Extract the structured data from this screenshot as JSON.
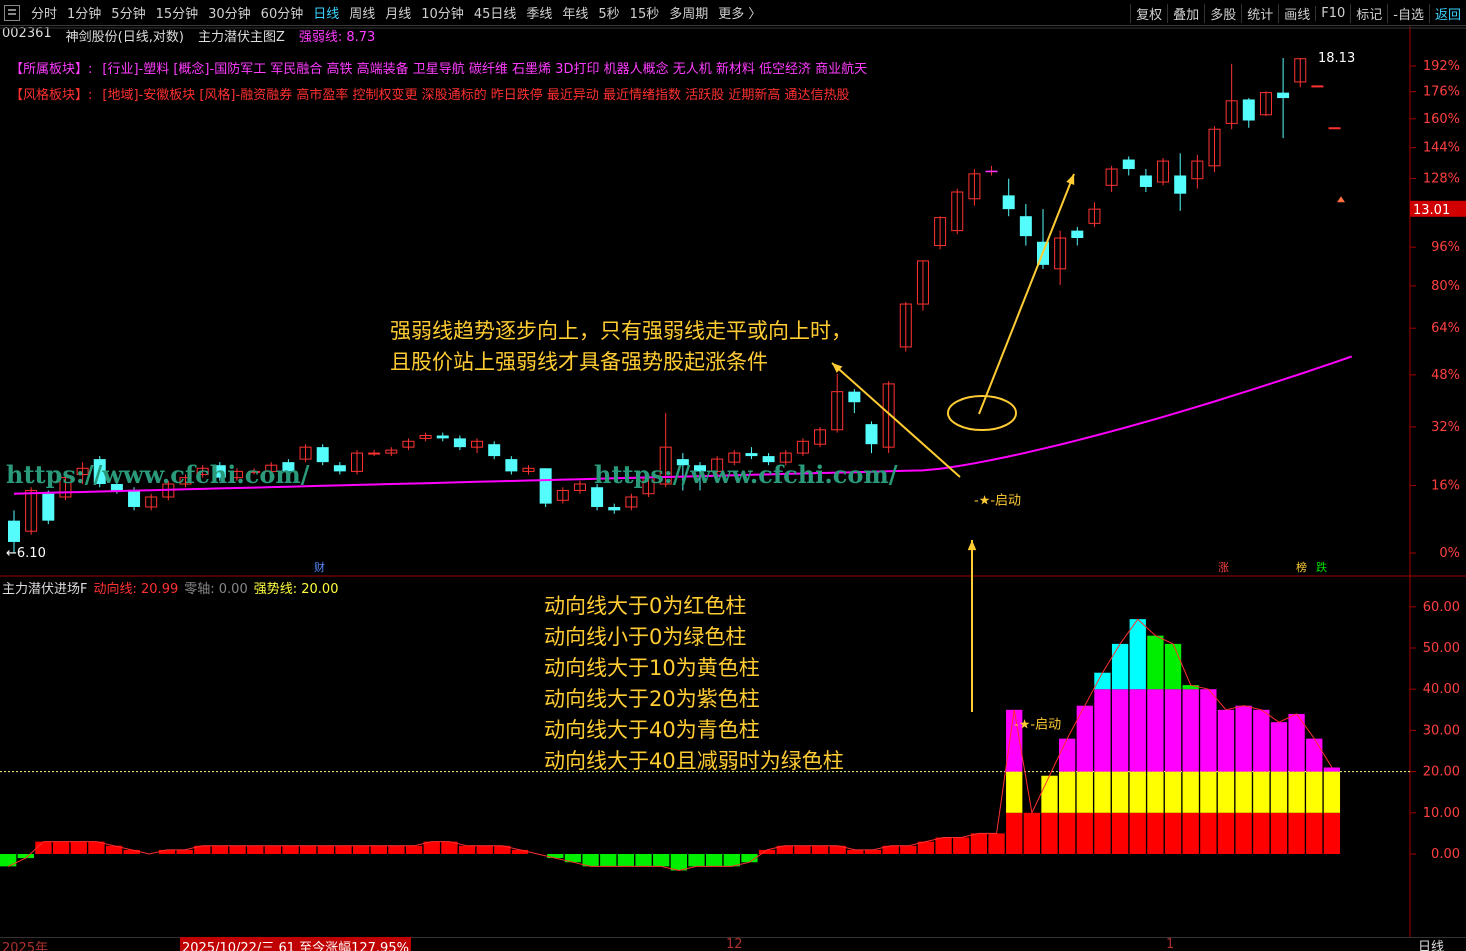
{
  "toolbar": {
    "periods": [
      "分时",
      "1分钟",
      "5分钟",
      "15分钟",
      "30分钟",
      "60分钟",
      "日线",
      "周线",
      "月线",
      "10分钟",
      "45日线",
      "季线",
      "年线",
      "5秒",
      "15秒",
      "多周期",
      "更多 〉"
    ],
    "active_period": "日线",
    "tools": [
      "复权",
      "叠加",
      "多股",
      "统计",
      "画线",
      "F10",
      "标记",
      "-自选",
      "返回"
    ]
  },
  "stock": {
    "code": "002361",
    "name": "神剑股份",
    "mode": "(日线,对数)",
    "indicator": "主力潜伏主图Z",
    "ind_label": "强弱线:",
    "ind_value": "8.73"
  },
  "sector": {
    "label": "【所属板块】:",
    "items": [
      "[行业]-塑料",
      "[概念]-国防军工",
      "军民融合",
      "高铁",
      "高端装备",
      "卫星导航",
      "碳纤维",
      "石墨烯",
      "3D打印",
      "机器人概念",
      "无人机",
      "新材料",
      "低空经济",
      "商业航天"
    ]
  },
  "style": {
    "label": "【风格板块】:",
    "items": [
      "[地域]-安徽板块",
      "[风格]-融资融券",
      "高市盈率",
      "控制权变更",
      "深股通标的",
      "昨日跌停",
      "最近异动",
      "最近情绪指数",
      "活跃股",
      "近期新高",
      "通达信热股"
    ]
  },
  "price_axis": [
    "192%",
    "176%",
    "160%",
    "144%",
    "128%",
    "96%",
    "80%",
    "64%",
    "48%",
    "32%",
    "16%",
    "0%"
  ],
  "current_price": "13.01",
  "high_label": "18.13",
  "low_label": "6.10",
  "start_label": "★-启动",
  "annotation_main": [
    "强弱线趋势逐步向上，只有强弱线走平或向上时，",
    "且股价站上强弱线才具备强势股起涨条件"
  ],
  "annotation_sub": [
    "动向线大于0为红色柱",
    "动向线小于0为绿色柱",
    "动向线大于10为黄色柱",
    "动向线大于20为紫色柱",
    "动向线大于40为青色柱",
    "动向线大于40且减弱时为绿色柱"
  ],
  "watermark": "https://www.cfchi.com/",
  "markers": {
    "cai": "财",
    "zhang": "涨",
    "bang": "榜",
    "die": "跌"
  },
  "sub": {
    "name": "主力潜伏进场F",
    "dx_label": "动向线:",
    "dx_value": "20.99",
    "zero_label": "零轴:",
    "zero_value": "0.00",
    "qs_label": "强势线:",
    "qs_value": "20.00"
  },
  "sub_axis": [
    "60.00",
    "50.00",
    "40.00",
    "30.00",
    "20.00",
    "10.00",
    "0.00"
  ],
  "bottom": {
    "year": "2025年",
    "date": "2025/10/22/三 61 至今涨幅127.95%",
    "m12": "12",
    "m1": "1",
    "period": "日线"
  },
  "colors": {
    "up": "#ff3232",
    "down": "#54fcfc",
    "strength_line": "#ff00ff",
    "annotation": "#ffcc33",
    "red": "#ff0000",
    "green": "#00ee00",
    "yellow": "#ffff00",
    "magenta": "#ff00ff",
    "cyan": "#00ffff"
  },
  "chart_data": {
    "type": "candlestick",
    "candles": [
      [
        6.55,
        6.25,
        6.7,
        6.1
      ],
      [
        6.4,
        7.0,
        7.05,
        6.35
      ],
      [
        6.95,
        6.55,
        7.0,
        6.5
      ],
      [
        6.9,
        7.2,
        7.25,
        6.85
      ],
      [
        7.25,
        7.35,
        7.45,
        7.1
      ],
      [
        7.5,
        7.1,
        7.55,
        7.05
      ],
      [
        7.1,
        7.0,
        7.2,
        6.95
      ],
      [
        7.0,
        6.75,
        7.05,
        6.7
      ],
      [
        6.75,
        6.9,
        6.95,
        6.7
      ],
      [
        6.9,
        7.1,
        7.15,
        6.85
      ],
      [
        7.1,
        7.2,
        7.25,
        7.05
      ],
      [
        7.25,
        7.35,
        7.4,
        7.2
      ],
      [
        7.4,
        7.2,
        7.45,
        7.15
      ],
      [
        7.2,
        7.3,
        7.35,
        7.15
      ],
      [
        7.3,
        7.3,
        7.35,
        7.25
      ],
      [
        7.3,
        7.4,
        7.45,
        7.25
      ],
      [
        7.45,
        7.3,
        7.5,
        7.25
      ],
      [
        7.5,
        7.7,
        7.75,
        7.45
      ],
      [
        7.7,
        7.45,
        7.75,
        7.4
      ],
      [
        7.4,
        7.3,
        7.45,
        7.25
      ],
      [
        7.3,
        7.6,
        7.65,
        7.25
      ],
      [
        7.6,
        7.6,
        7.65,
        7.55
      ],
      [
        7.6,
        7.65,
        7.7,
        7.55
      ],
      [
        7.7,
        7.8,
        7.85,
        7.65
      ],
      [
        7.85,
        7.9,
        7.95,
        7.8
      ],
      [
        7.9,
        7.85,
        7.95,
        7.8
      ],
      [
        7.85,
        7.7,
        7.9,
        7.65
      ],
      [
        7.7,
        7.8,
        7.85,
        7.6
      ],
      [
        7.75,
        7.55,
        7.8,
        7.5
      ],
      [
        7.5,
        7.3,
        7.55,
        7.25
      ],
      [
        7.3,
        7.35,
        7.4,
        7.25
      ],
      [
        7.35,
        6.8,
        7.35,
        6.75
      ],
      [
        6.85,
        7.0,
        7.05,
        6.8
      ],
      [
        7.0,
        7.1,
        7.15,
        6.95
      ],
      [
        7.05,
        6.75,
        7.1,
        6.7
      ],
      [
        6.75,
        6.7,
        6.8,
        6.65
      ],
      [
        6.75,
        6.9,
        6.95,
        6.7
      ],
      [
        6.95,
        7.2,
        7.25,
        6.9
      ],
      [
        7.1,
        7.7,
        8.3,
        7.05
      ],
      [
        7.5,
        7.4,
        7.6,
        7.0
      ],
      [
        7.4,
        7.3,
        7.45,
        7.0
      ],
      [
        7.3,
        7.5,
        7.55,
        7.25
      ],
      [
        7.45,
        7.6,
        7.65,
        7.4
      ],
      [
        7.6,
        7.55,
        7.7,
        7.5
      ],
      [
        7.55,
        7.45,
        7.6,
        7.4
      ],
      [
        7.45,
        7.6,
        7.65,
        7.4
      ],
      [
        7.6,
        7.8,
        7.85,
        7.55
      ],
      [
        7.75,
        8.0,
        8.05,
        7.7
      ],
      [
        8.0,
        8.7,
        9.05,
        7.95
      ],
      [
        8.7,
        8.5,
        8.75,
        8.3
      ],
      [
        8.1,
        7.75,
        8.15,
        7.6
      ],
      [
        7.7,
        8.85,
        8.9,
        7.6
      ],
      [
        9.6,
        10.55,
        10.6,
        9.5
      ],
      [
        10.55,
        11.6,
        11.6,
        10.4
      ],
      [
        12.0,
        12.76,
        12.8,
        11.9
      ],
      [
        12.4,
        13.5,
        13.6,
        12.3
      ],
      [
        13.3,
        14.05,
        14.2,
        13.1
      ],
      [
        14.1,
        14.15,
        14.3,
        14.0
      ],
      [
        13.4,
        13.0,
        13.9,
        12.8
      ],
      [
        12.8,
        12.25,
        13.15,
        12.0
      ],
      [
        12.1,
        11.5,
        13.0,
        11.4
      ],
      [
        11.4,
        12.2,
        12.4,
        11.0
      ],
      [
        12.4,
        12.2,
        12.5,
        12.0
      ],
      [
        12.6,
        13.0,
        13.2,
        12.5
      ],
      [
        13.7,
        14.2,
        14.3,
        13.5
      ],
      [
        14.5,
        14.2,
        14.6,
        14.0
      ],
      [
        14.0,
        13.65,
        14.2,
        13.5
      ],
      [
        13.8,
        14.45,
        14.55,
        13.7
      ],
      [
        14.0,
        13.45,
        14.7,
        12.95
      ],
      [
        13.9,
        14.45,
        14.65,
        13.6
      ],
      [
        14.3,
        15.5,
        15.6,
        14.1
      ],
      [
        15.7,
        16.5,
        17.9,
        15.5
      ],
      [
        16.55,
        15.8,
        16.6,
        15.55
      ],
      [
        16.0,
        16.8,
        16.85,
        15.95
      ],
      [
        16.8,
        16.6,
        18.13,
        15.2
      ],
      [
        17.2,
        18.1,
        18.13,
        17.0
      ],
      [
        17.05,
        17.05,
        17.05,
        17.05
      ],
      [
        15.55,
        15.55,
        15.55,
        15.55
      ]
    ],
    "strength_line_start": 6.95,
    "strength_line_end": 9.4,
    "sub_bars": [
      -3,
      -1,
      3,
      3,
      3,
      3,
      2,
      1,
      0,
      1,
      1,
      2,
      2,
      2,
      2,
      2,
      2,
      2,
      2,
      2,
      2,
      2,
      2,
      2,
      3,
      3,
      2,
      2,
      2,
      1,
      0,
      -1,
      -2,
      -3,
      -3,
      -3,
      -3,
      -3,
      -4,
      -3,
      -3,
      -3,
      -2,
      1,
      2,
      2,
      2,
      2,
      1,
      1,
      2,
      2,
      3,
      4,
      4,
      5,
      5,
      35,
      10,
      19,
      28,
      36,
      44,
      51,
      57,
      53,
      51,
      41,
      40,
      35,
      36,
      35,
      32,
      34,
      28,
      21
    ],
    "sub_signal": 20
  }
}
